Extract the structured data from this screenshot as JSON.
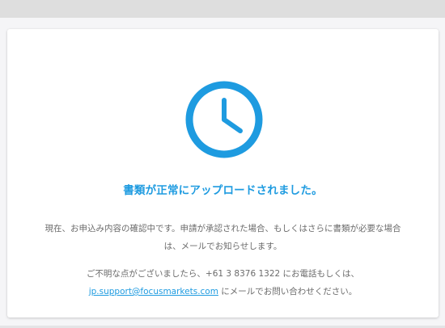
{
  "title": "書類が正常にアップロードされました。",
  "message1": {
    "line1": "現在、お申込み内容の確認中です。申請が承認された場合、もしくはさらに書類が必要な場合",
    "line2": "は、メールでお知らせします。"
  },
  "message2": {
    "line1": "ご不明な点がございましたら、+61 3 8376 1322 にお電話もしくは、",
    "email": "jp.support@focusmarkets.com",
    "line2_suffix": " にメールでお問い合わせください。"
  },
  "icon": "clock-icon",
  "colors": {
    "accent": "#1e9be0",
    "text": "#6b6b6b",
    "card": "#ffffff",
    "background": "#f5f5f7"
  }
}
